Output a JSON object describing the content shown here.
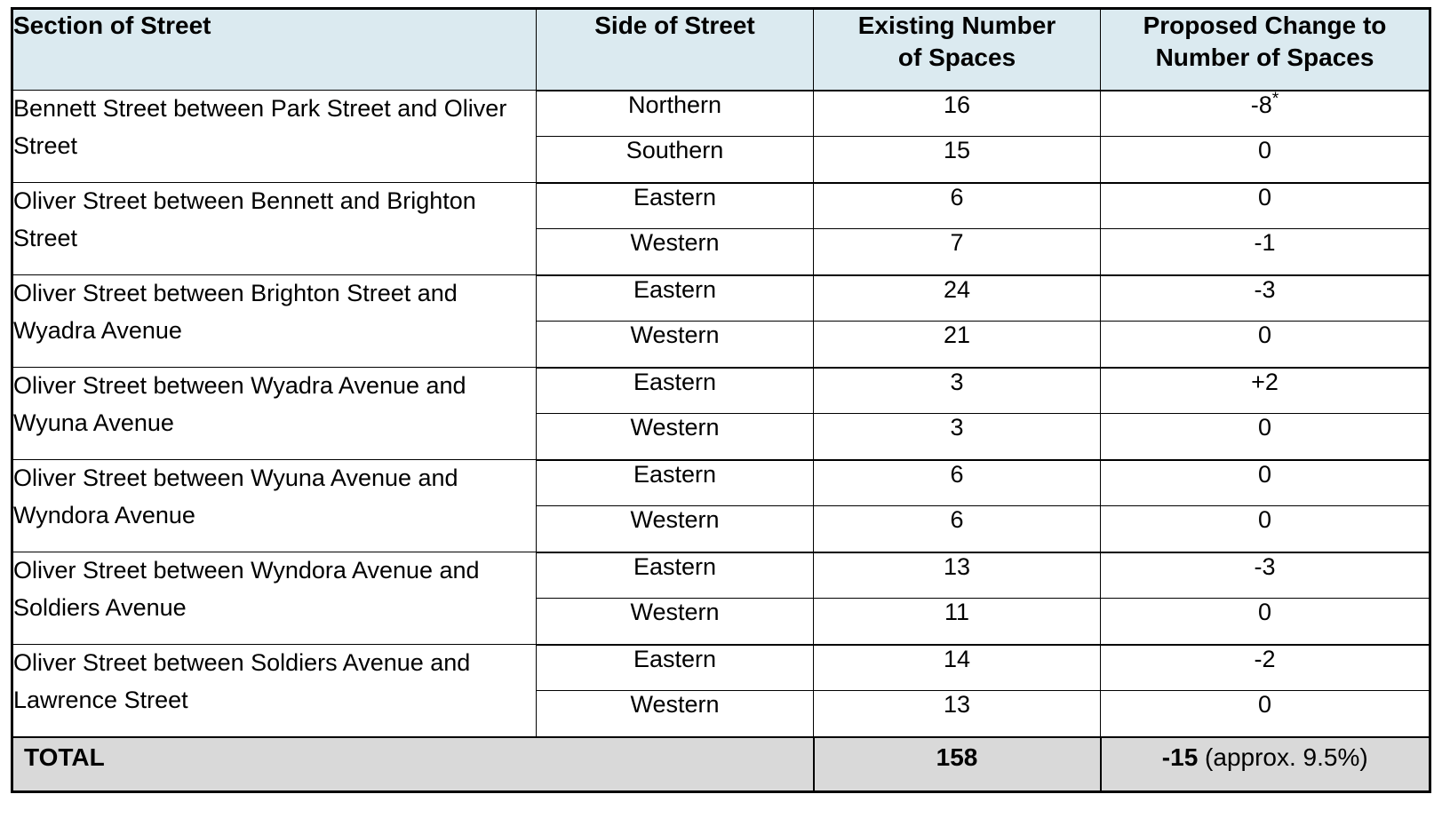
{
  "table": {
    "headers": {
      "section": "Section of Street",
      "side": "Side of Street",
      "existing": "Existing Number of Spaces",
      "existing_line1": "Existing Number",
      "existing_line2": "of Spaces",
      "proposed": "Proposed Change to Number of Spaces",
      "proposed_line1": "Proposed Change to",
      "proposed_line2": "Number of Spaces"
    },
    "sections": [
      {
        "name": "Bennett Street between Park Street and Oliver Street",
        "rows": [
          {
            "side": "Northern",
            "existing": "16",
            "proposed": "-8",
            "proposed_note": "*"
          },
          {
            "side": "Southern",
            "existing": "15",
            "proposed": "0",
            "proposed_note": ""
          }
        ]
      },
      {
        "name": "Oliver Street between Bennett and Brighton Street",
        "rows": [
          {
            "side": "Eastern",
            "existing": "6",
            "proposed": "0",
            "proposed_note": ""
          },
          {
            "side": "Western",
            "existing": "7",
            "proposed": "-1",
            "proposed_note": ""
          }
        ]
      },
      {
        "name": "Oliver Street between Brighton Street and Wyadra Avenue",
        "rows": [
          {
            "side": "Eastern",
            "existing": "24",
            "proposed": "-3",
            "proposed_note": ""
          },
          {
            "side": "Western",
            "existing": "21",
            "proposed": "0",
            "proposed_note": ""
          }
        ]
      },
      {
        "name": "Oliver Street between Wyadra Avenue and Wyuna Avenue",
        "rows": [
          {
            "side": "Eastern",
            "existing": "3",
            "proposed": "+2",
            "proposed_note": ""
          },
          {
            "side": "Western",
            "existing": "3",
            "proposed": "0",
            "proposed_note": ""
          }
        ]
      },
      {
        "name": "Oliver Street between Wyuna Avenue and Wyndora Avenue",
        "rows": [
          {
            "side": "Eastern",
            "existing": "6",
            "proposed": "0",
            "proposed_note": ""
          },
          {
            "side": "Western",
            "existing": "6",
            "proposed": "0",
            "proposed_note": ""
          }
        ]
      },
      {
        "name": "Oliver Street between Wyndora Avenue and Soldiers Avenue",
        "rows": [
          {
            "side": "Eastern",
            "existing": "13",
            "proposed": "-3",
            "proposed_note": ""
          },
          {
            "side": "Western",
            "existing": "11",
            "proposed": "0",
            "proposed_note": ""
          }
        ]
      },
      {
        "name": "Oliver Street between Soldiers Avenue and Lawrence Street",
        "rows": [
          {
            "side": "Eastern",
            "existing": "14",
            "proposed": "-2",
            "proposed_note": ""
          },
          {
            "side": "Western",
            "existing": "13",
            "proposed": "0",
            "proposed_note": ""
          }
        ]
      }
    ],
    "total": {
      "label": "TOTAL",
      "existing": "158",
      "proposed_bold": "-15",
      "proposed_rest": " (approx. 9.5%)"
    },
    "colors": {
      "header_background": "#dbeaf0",
      "total_background": "#d9d9d9",
      "border": "#000000",
      "text": "#000000"
    }
  }
}
